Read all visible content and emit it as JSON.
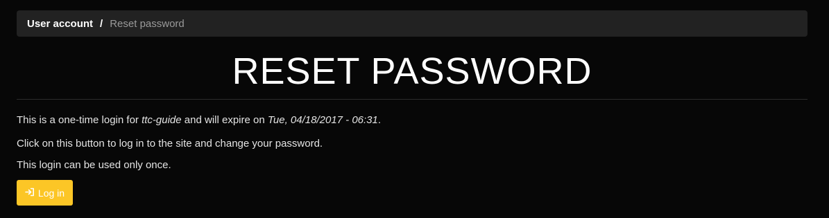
{
  "breadcrumb": {
    "parent": "User account",
    "separator": "/",
    "current": "Reset password"
  },
  "page": {
    "title": "RESET PASSWORD"
  },
  "message": {
    "line1_prefix": "This is a one-time login for ",
    "username": "ttc-guide",
    "line1_middle": " and will expire on ",
    "expiry": "Tue, 04/18/2017 - 06:31",
    "line1_suffix": ".",
    "line2": "Click on this button to log in to the site and change your password.",
    "line3": "This login can be used only once."
  },
  "login_button": {
    "label": "Log in",
    "icon": "sign-in-icon",
    "color": "#fcc626"
  }
}
